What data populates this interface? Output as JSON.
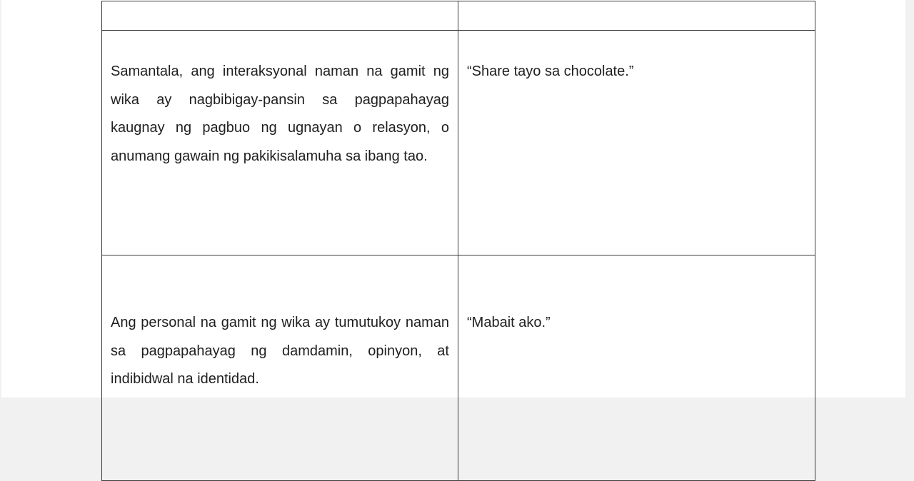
{
  "table": {
    "header": [
      "",
      ""
    ],
    "rows": [
      {
        "description": "Samantala, ang interaksyonal naman na gamit ng wika ay nagbibigay-pansin sa pagpapahayag kaugnay ng pagbuo ng ugnayan o relasyon, o anumang gawain ng pakikisalamuha sa ibang tao.",
        "example": "“Share tayo sa chocolate.”"
      },
      {
        "description": "Ang personal na gamit ng wika ay tumutukoy naman sa pagpapahayag ng damdamin, opinyon, at indibidwal na identidad.",
        "example": "“Mabait ako.”"
      }
    ]
  }
}
